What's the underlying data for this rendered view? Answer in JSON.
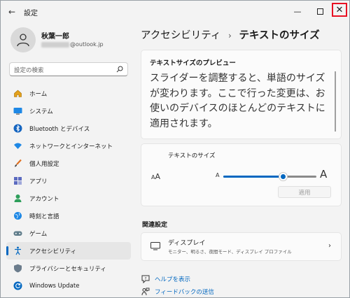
{
  "titlebar": {
    "app_title": "設定"
  },
  "user": {
    "name": "秋葉一郎",
    "email_suffix": "@outlook.jp"
  },
  "search": {
    "placeholder": "設定の検索"
  },
  "sidebar": {
    "items": [
      {
        "label": "ホーム",
        "icon": "home-icon"
      },
      {
        "label": "システム",
        "icon": "system-icon"
      },
      {
        "label": "Bluetooth とデバイス",
        "icon": "bluetooth-icon"
      },
      {
        "label": "ネットワークとインターネット",
        "icon": "wifi-icon"
      },
      {
        "label": "個人用設定",
        "icon": "brush-icon"
      },
      {
        "label": "アプリ",
        "icon": "apps-icon"
      },
      {
        "label": "アカウント",
        "icon": "account-icon"
      },
      {
        "label": "時刻と言語",
        "icon": "globe-icon"
      },
      {
        "label": "ゲーム",
        "icon": "gamepad-icon"
      },
      {
        "label": "アクセシビリティ",
        "icon": "accessibility-icon",
        "active": true
      },
      {
        "label": "プライバシーとセキュリティ",
        "icon": "shield-icon"
      },
      {
        "label": "Windows Update",
        "icon": "update-icon"
      }
    ]
  },
  "breadcrumb": {
    "parent": "アクセシビリティ",
    "separator": "›",
    "current": "テキストのサイズ"
  },
  "preview": {
    "title": "テキストサイズのプレビュー",
    "text": "スライダーを調整すると、単語のサイズが変わります。ここで行った変更は、お使いのデバイスのほとんどのテキストに適用されます。"
  },
  "text_size": {
    "label": "テキストのサイズ",
    "icon": "text-size-icon",
    "small_marker": "A",
    "large_marker": "A",
    "slider_value_fraction": 0.64,
    "apply_label": "適用"
  },
  "related": {
    "heading": "関連設定",
    "display_title": "ディスプレイ",
    "display_subtitle": "モニター、明るさ、夜間モード、ディスプレイ プロファイル"
  },
  "links": {
    "help": "ヘルプを表示",
    "feedback": "フィードバックの送信"
  },
  "colors": {
    "accent": "#0067c0",
    "close_highlight": "#e81123"
  }
}
